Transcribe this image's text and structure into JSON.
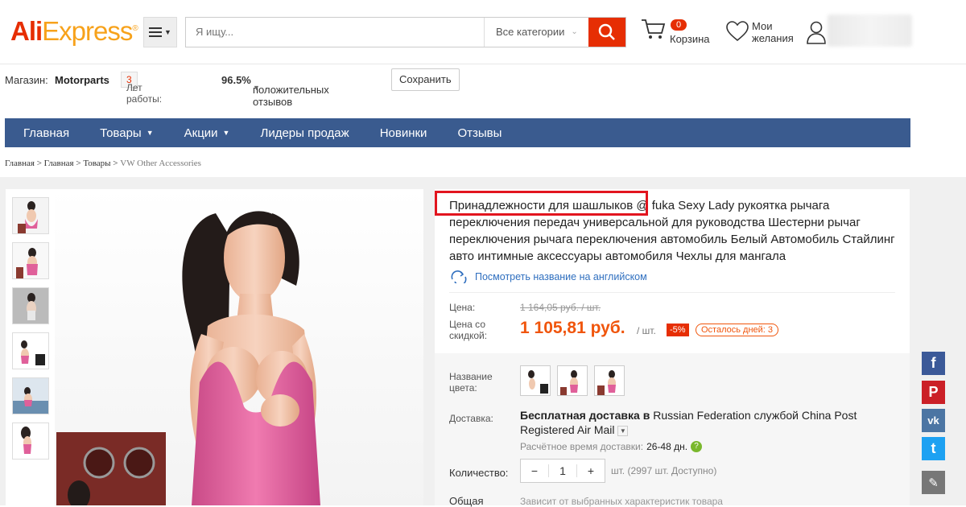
{
  "header": {
    "logo_main": "Ali",
    "logo_rest": "Express",
    "logo_mark": "®",
    "search_placeholder": "Я ищу...",
    "category_select": "Все категории",
    "cart_count": "0",
    "cart_label": "Корзина",
    "wishlist_line1": "Мои",
    "wishlist_line2": "желания",
    "icons": [
      "menu-icon",
      "search-icon",
      "cart-icon",
      "heart-icon",
      "user-icon"
    ]
  },
  "store": {
    "label": "Магазин:",
    "name": "Motorparts",
    "years_label": "Лет работы:",
    "years_value": "3",
    "years_dot": ".",
    "positive_pct": "96.5%",
    "positive_label": "положительных отзывов",
    "save_label": "Сохранить"
  },
  "nav": {
    "items": [
      {
        "label": "Главная"
      },
      {
        "label": "Товары"
      },
      {
        "label": "Акции"
      },
      {
        "label": "Лидеры продаж"
      },
      {
        "label": "Новинки"
      },
      {
        "label": "Отзывы"
      }
    ]
  },
  "breadcrumb": {
    "items": [
      "Главная",
      "Главная",
      "Товары",
      "VW Other Accessories"
    ],
    "separator": ">"
  },
  "product": {
    "title_highlight": "Принадлежности для шашлыков",
    "title_rest": " @ fuka Sexy Lady рукоятка рычага переключения передач универсальной для руководства Шестерни рычаг переключения рычага переключения автомобиль Белый Автомобиль Стайлинг авто интимные аксессуары автомобиля Чехлы для мангала",
    "translate_link": "Посмотреть название на английском",
    "price_label": "Цена:",
    "old_price": "1 164,05 руб. / шт.",
    "sale_label_1": "Цена со",
    "sale_label_2": "скидкой:",
    "sale_price": "1 105,81 руб.",
    "unit": "/ шт.",
    "discount": "-5%",
    "days_left": "Осталось дней: 3",
    "color_label_1": "Название",
    "color_label_2": "цвета:",
    "delivery_label": "Доставка:",
    "delivery_bold": "Бесплатная доставка в",
    "delivery_rest": " Russian Federation службой China Post Registered Air Mail",
    "eta_label": "Расчётное время доставки:",
    "eta_value": "26-48 дн.",
    "qty_label": "Количество:",
    "qty_minus": "−",
    "qty_value": "1",
    "qty_plus": "+",
    "stock": "шт. (2997 шт. Доступно)",
    "total_label": "Общая",
    "total_note": "Зависит от выбранных характеристик товара"
  },
  "social": {
    "facebook": "f",
    "pinterest": "P",
    "vk": "vk",
    "twitter": "t",
    "edit": "✎",
    "colors": {
      "facebook": "#3b5998",
      "pinterest": "#cb2027",
      "vk": "#4c75a3",
      "twitter": "#1da1f2",
      "edit": "#777777"
    }
  },
  "colors": {
    "accent": "#e62e04",
    "price": "#f0550c",
    "nav": "#3a5b8f",
    "link": "#2f6fbf"
  }
}
